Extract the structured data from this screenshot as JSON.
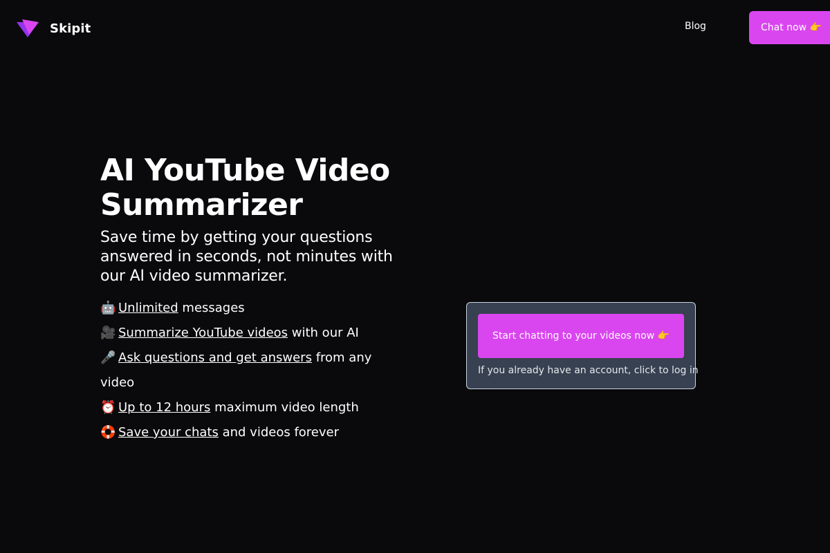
{
  "header": {
    "brand_name": "Skipit",
    "logo_icon": "skipit-triangle-logo",
    "nav_blog": "Blog",
    "cta_label": "Chat now 👉"
  },
  "hero": {
    "title": "AI YouTube Video Summarizer",
    "subtitle": "Save time by getting your questions answered in seconds, not minutes with our AI video summarizer.",
    "features": [
      {
        "emoji": "🤖",
        "link": "Unlimited",
        "text": " messages"
      },
      {
        "emoji": "🎥",
        "link": "Summarize YouTube videos",
        "text": " with our AI"
      },
      {
        "emoji": "🎤",
        "link": "Ask questions and get answers",
        "text": " from any video"
      },
      {
        "emoji": "⏰",
        "link": "Up to 12 hours",
        "text": " maximum video length"
      },
      {
        "emoji": "🛟",
        "link": "Save your chats",
        "text": " and videos forever"
      }
    ]
  },
  "cta_card": {
    "button_label": "Start chatting to your videos now 👉",
    "login_text": "If you already have an account, click to log in"
  },
  "colors": {
    "background": "#0a0a0c",
    "accent": "#d946ef",
    "card": "#374151"
  }
}
